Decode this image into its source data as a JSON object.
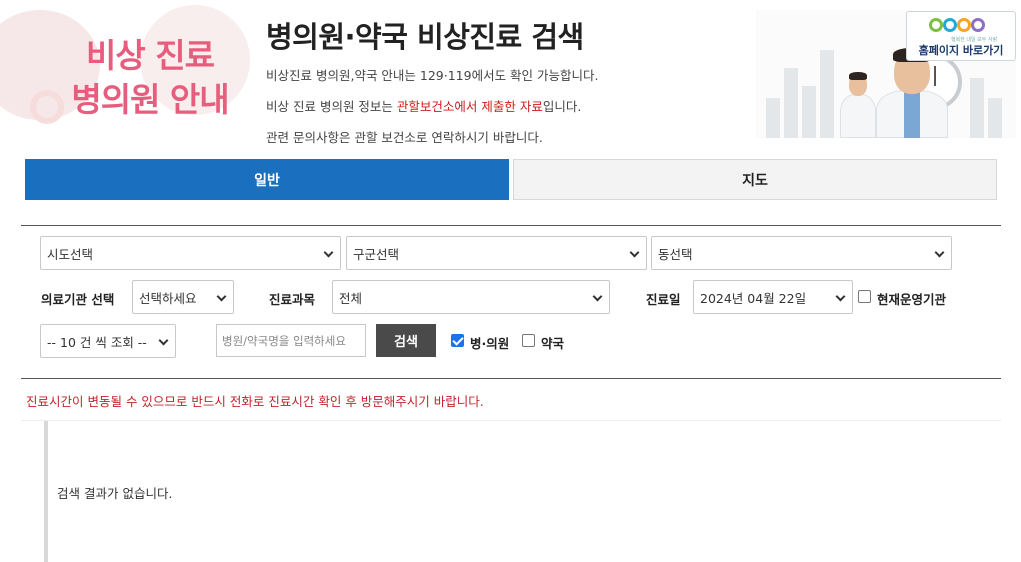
{
  "banner": {
    "title_line1": "비상 진료",
    "title_line2": "병의원 안내"
  },
  "header": {
    "title": "병의원·약국 비상진료 검색",
    "desc_line1": "비상진료 병의원,약국 안내는 129·119에서도 확인 가능합니다.",
    "desc_line2_pre": "비상 진료 병의원 정보는 ",
    "desc_line2_highlight": "관할보건소에서 제출한 자료",
    "desc_line2_post": "입니다.",
    "desc_line3": "관련 문의사항은 관할 보건소로 연락하시기 바랍니다."
  },
  "home_link": {
    "label": "홈페이지 바로가기",
    "tagline": "행복한 내일 모두 사랑"
  },
  "tabs": [
    {
      "label": "일반",
      "active": true
    },
    {
      "label": "지도",
      "active": false
    }
  ],
  "filters": {
    "sido": "시도선택",
    "gugun": "구군선택",
    "dong": "동선택",
    "institution_label": "의료기관 선택",
    "institution_value": "선택하세요",
    "department_label": "진료과목",
    "department_value": "전체",
    "date_label": "진료일",
    "date_value": "2024년 04월 22일",
    "open_now_label": "현재운영기관",
    "open_now_checked": false,
    "page_size": "-- 10 건 씩 조회 --",
    "search_placeholder": "병원/약국명을 입력하세요",
    "search_button": "검색",
    "hospital_label": "병·의원",
    "hospital_checked": true,
    "pharmacy_label": "약국",
    "pharmacy_checked": false
  },
  "notice": "진료시간이 변동될 수 있으므로 반드시 전화로 진료시간 확인 후 방문해주시기 바랍니다.",
  "results": {
    "empty_message": "검색 결과가 없습니다."
  },
  "colors": {
    "primary_tab": "#1a6fbf",
    "banner_pink": "#e85d7d",
    "notice_red": "#c0242e",
    "search_button": "#4a4a4a"
  }
}
